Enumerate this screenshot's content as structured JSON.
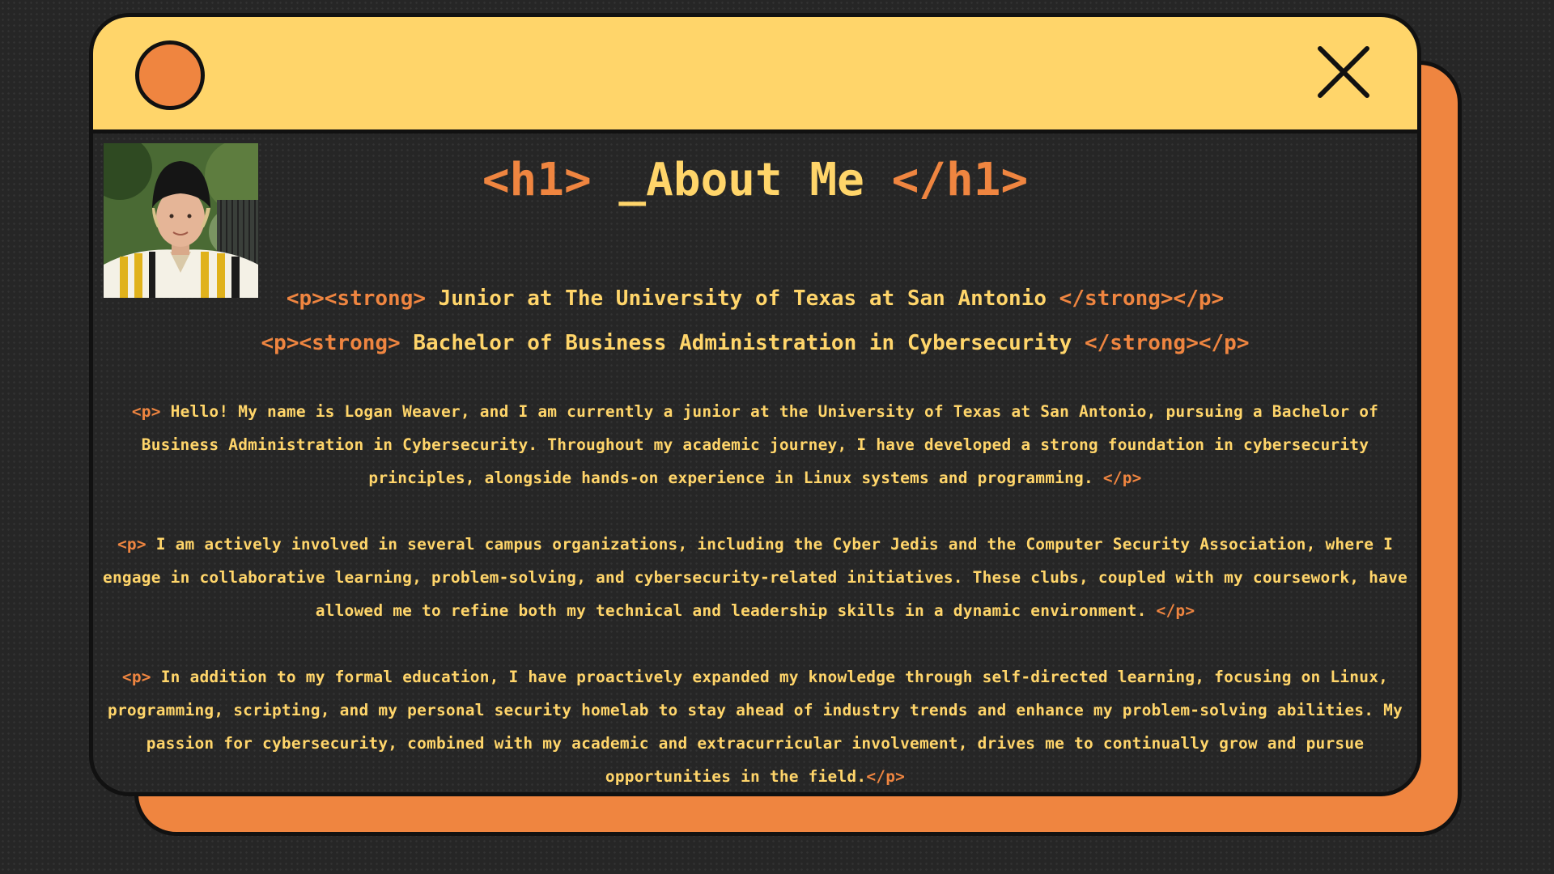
{
  "colors": {
    "background": "#262626",
    "titlebar": "#FFD56A",
    "accent": "#EF8540",
    "text": "#FFD56A",
    "outline": "#111111"
  },
  "window": {
    "dot_icon": "orange-circle-icon",
    "close_icon": "close-x-icon"
  },
  "profile": {
    "photo_icon": "profile-photo"
  },
  "heading": {
    "open_tag": "<h1>",
    "text": " _About Me ",
    "close_tag": "</h1>"
  },
  "subtitles": [
    {
      "open_tag": "<p><strong>",
      "text": " Junior at The University of Texas at San Antonio ",
      "close_tag": "</strong></p>"
    },
    {
      "open_tag": "<p><strong>",
      "text": " Bachelor of Business Administration in Cybersecurity ",
      "close_tag": "</strong></p>"
    }
  ],
  "paragraphs": [
    {
      "open_tag": "<p>",
      "text": " Hello! My name is Logan Weaver, and I am currently a junior at the University of Texas at San Antonio, pursuing a Bachelor of Business Administration in Cybersecurity. Throughout my academic journey, I have developed a strong foundation in cybersecurity principles, alongside hands-on experience in Linux systems and programming. ",
      "close_tag": "</p>"
    },
    {
      "open_tag": "<p>",
      "text": " I am actively involved in several campus organizations, including the Cyber Jedis and the Computer Security Association, where I engage in collaborative learning, problem-solving, and cybersecurity-related initiatives. These clubs, coupled with my coursework, have allowed me to refine both my technical and leadership skills in a dynamic environment. ",
      "close_tag": "</p>"
    },
    {
      "open_tag": "<p>",
      "text": " In addition to my formal education, I have proactively expanded my knowledge through self-directed learning, focusing on Linux, programming, scripting, and my personal security homelab to stay ahead of industry trends and enhance my problem-solving abilities. My passion for cybersecurity, combined with my academic and extracurricular involvement, drives me to continually grow and pursue opportunities in the field.",
      "close_tag": "</p>"
    }
  ]
}
